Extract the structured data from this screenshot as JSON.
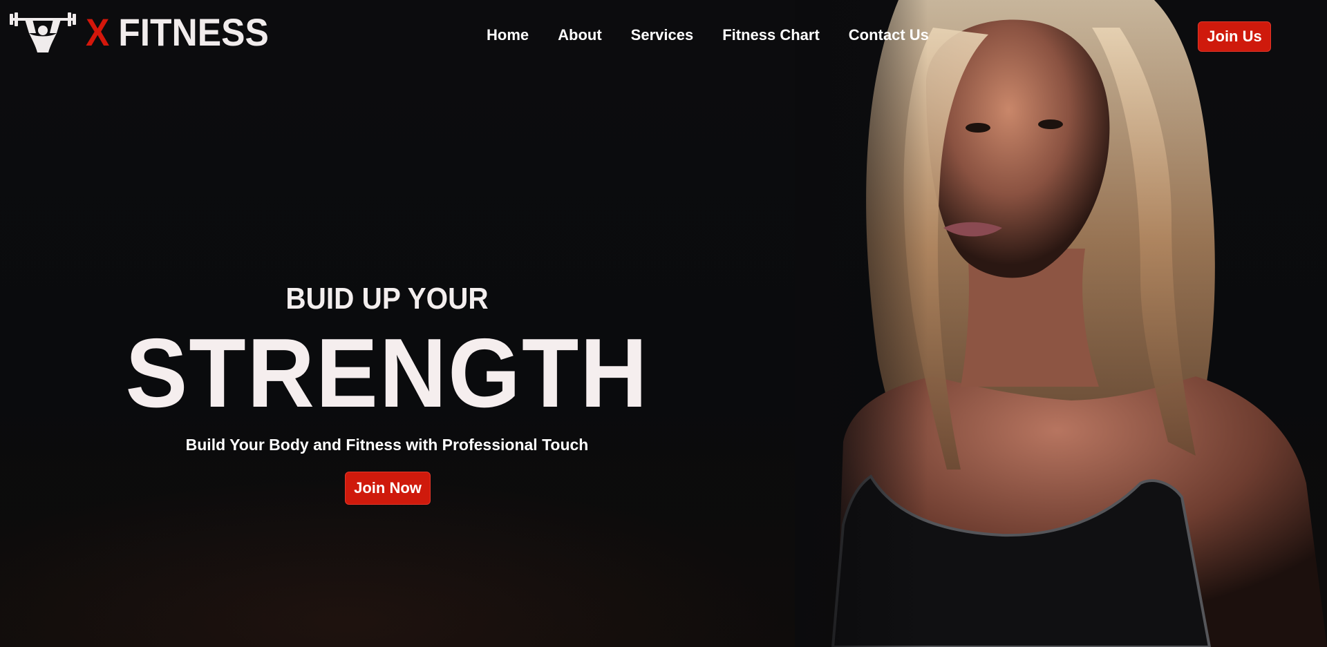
{
  "brand": {
    "logo_icon": "barbell-lifter-icon",
    "prefix": "X",
    "name": "FITNESS",
    "accent_color": "#d4170b"
  },
  "nav": {
    "items": [
      {
        "label": "Home"
      },
      {
        "label": "About"
      },
      {
        "label": "Services"
      },
      {
        "label": "Fitness Chart"
      },
      {
        "label": "Contact Us"
      }
    ],
    "cta_label": "Join Us"
  },
  "hero": {
    "subheading": "BUID UP YOUR",
    "heading": "STRENGTH",
    "tagline": "Build Your Body and Fitness with Professional Touch",
    "cta_label": "Join Now",
    "background_image": "woman-athlete-portrait"
  },
  "colors": {
    "background": "#0b0b0d",
    "button": "#cf1a0c",
    "text": "#ffffff"
  }
}
